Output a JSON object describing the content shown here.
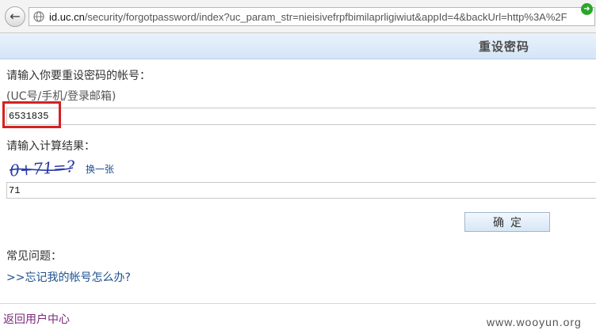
{
  "browser": {
    "url_host": "id.uc.cn",
    "url_rest": "/security/forgotpassword/index?uc_param_str=nieisivefrpfbimilaprligiwiut&appId=4&backUrl=http%3A%2F"
  },
  "header": {
    "title": "重设密码"
  },
  "form": {
    "account_label": "请输入你要重设密码的帐号：",
    "account_hint": "(UC号/手机/登录邮箱)",
    "account_value": "6531835",
    "captcha_label": "请输入计算结果：",
    "captcha_text": "0+71=?",
    "refresh_label": "换一张",
    "answer_value": "71",
    "confirm_label": "确定"
  },
  "faq": {
    "title": "常见问题：",
    "link_text": ">>忘记我的帐号怎么办?"
  },
  "footer": {
    "back_link": "返回用户中心",
    "watermark": "www.wooyun.org"
  },
  "colors": {
    "highlight": "#d62020",
    "link": "#1c4f8e",
    "header_bg": "#d4e5f6"
  }
}
